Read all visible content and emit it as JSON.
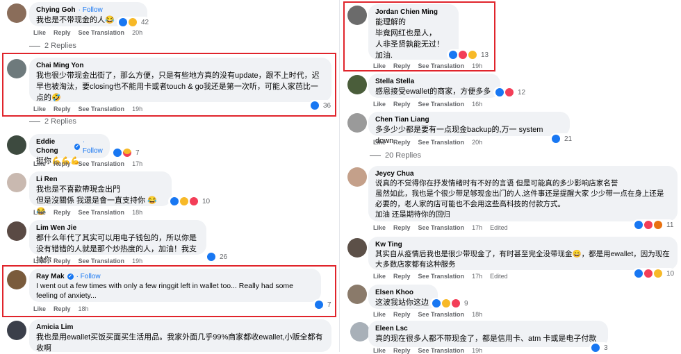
{
  "actions": {
    "like": "Like",
    "reply": "Reply",
    "see_translation": "See Translation",
    "edited": "Edited"
  },
  "left": [
    {
      "name": "Chying Goh",
      "follow": "· Follow",
      "text": "我也是不带现金的人😂",
      "reactions": [
        "like",
        "haha"
      ],
      "count": "42",
      "time": "20h"
    },
    {
      "replies": "2 Replies"
    },
    {
      "name": "Chai Ming Yon",
      "text": "我也很少带现金出街了，那么方便，只是有些地方真的没有update，跟不上时代，迟早也被淘汰，要closing也不能用卡或者touch & go我还是第一次听，可能人家芭比一点的🤣",
      "reactions": [
        "like"
      ],
      "count": "36",
      "time": "19h"
    },
    {
      "replies": "2 Replies"
    },
    {
      "name": "Eddie Chong",
      "follow": "· Follow",
      "text": "挺你💪💪💪",
      "reactions": [
        "like",
        "care"
      ],
      "count": "7",
      "time": "17h"
    },
    {
      "name": "Li Ren",
      "text": "我也是不喜歡帶現金出門\n但是沒關係 我還是會一直支持你 😂😂",
      "reactions": [
        "like",
        "haha",
        "love"
      ],
      "count": "10",
      "time": "18h"
    },
    {
      "name": "Lim Wen Jie",
      "text": "都什么年代了其实可以用电子钱包的，所以你是没有错错的人就是那个炒热度的人，加油！我支持你",
      "reactions": [
        "like"
      ],
      "count": "26",
      "time": "19h"
    },
    {
      "name": "Ray Mak",
      "follow": "· Follow",
      "text": "I went out a few times with only a few ringgit left in wallet too... Really had some feeling of anxiety...",
      "reactions": [
        "like"
      ],
      "count": "7",
      "time": "18h"
    },
    {
      "name": "Amicia Lim",
      "text": "我也是用ewallet买饭买面买生活用品。我家外面几乎99%商家都收ewallet,小贩全都有收啊"
    }
  ],
  "right": [
    {
      "name": "Jordan Chien Ming",
      "text": "能理解的\n毕竟网红也是人，\n人非圣贤孰能无过！\n加油.",
      "reactions": [
        "like",
        "love",
        "haha"
      ],
      "count": "13",
      "time": "19h"
    },
    {
      "name": "Stella Stella",
      "text": "感恩接受ewallet的商家，方便多多",
      "reactions": [
        "like",
        "love"
      ],
      "count": "12",
      "time": "16h"
    },
    {
      "name": "Chen Tian Liang",
      "text": "多多少少都是要有一点现金backup的,万一 system down.",
      "reactions": [
        "like"
      ],
      "count": "21",
      "time": "20h"
    },
    {
      "replies": "20 Replies"
    },
    {
      "name": "Jeycy Chua",
      "text": "说真的不觉得你在抒发情绪时有不好的言语 但是可能真的多少影响店家名誉\n虽然如此，我也是个很少带足够现金出门的人,这件事还是提醒大家 少少带一点在身上还是必要的，老人家的店可能也不会用这些高科技的付款方式。\n加油 还是期待你的回归",
      "reactions": [
        "like",
        "love",
        "angry"
      ],
      "count": "11",
      "time": "17h",
      "edited": true
    },
    {
      "name": "Kw Ting",
      "text": "其实自从疫情后我也是很少带现金了，有时甚至完全没带现金😄，都是用ewallet，因为现在大多数店家都有这种服务",
      "reactions": [
        "like",
        "love",
        "haha"
      ],
      "count": "10",
      "time": "17h",
      "edited": true
    },
    {
      "name": "Elsen Khoo",
      "text": "这波我站你这边",
      "reactions": [
        "like",
        "haha",
        "love"
      ],
      "count": "9",
      "time": "18h"
    },
    {
      "name": "Eleen Lsc",
      "text": "真的现在很多人都不带现金了，都是信用卡、atm 卡或是电子付款",
      "reactions": [
        "like"
      ],
      "count": "3",
      "time": "19h"
    }
  ],
  "colors": {
    "highlight": "#e0242b",
    "like": "#1877f2",
    "bubble": "#f0f2f5"
  }
}
